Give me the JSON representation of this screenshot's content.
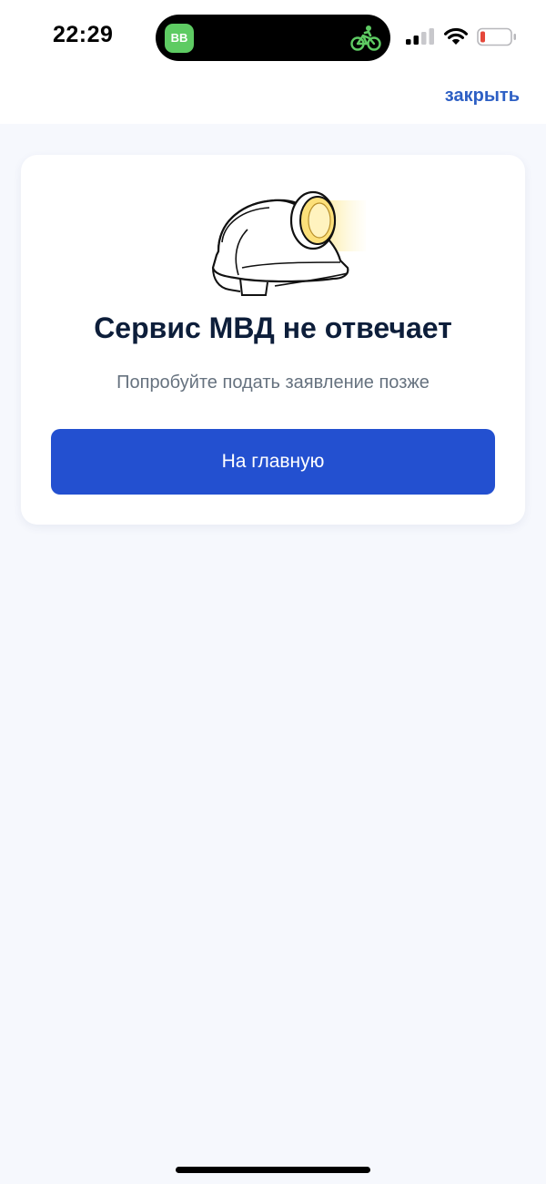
{
  "status_bar": {
    "time": "22:29",
    "island_app_badge": "BB",
    "island_app_color": "#5ecb63",
    "activity_icon": "bicycle-icon",
    "signal_bars_active": 2,
    "signal_bars_total": 4,
    "battery_level": "low",
    "battery_color": "#e5473a"
  },
  "header": {
    "close_label": "закрыть",
    "accent_color": "#2d5fc4"
  },
  "error_card": {
    "illustration": "helmet-with-lamp-icon",
    "title": "Сервис МВД не отвечает",
    "message": "Попробуйте подать заявление позже",
    "button_label": "На главную",
    "button_color": "#2350d0"
  }
}
